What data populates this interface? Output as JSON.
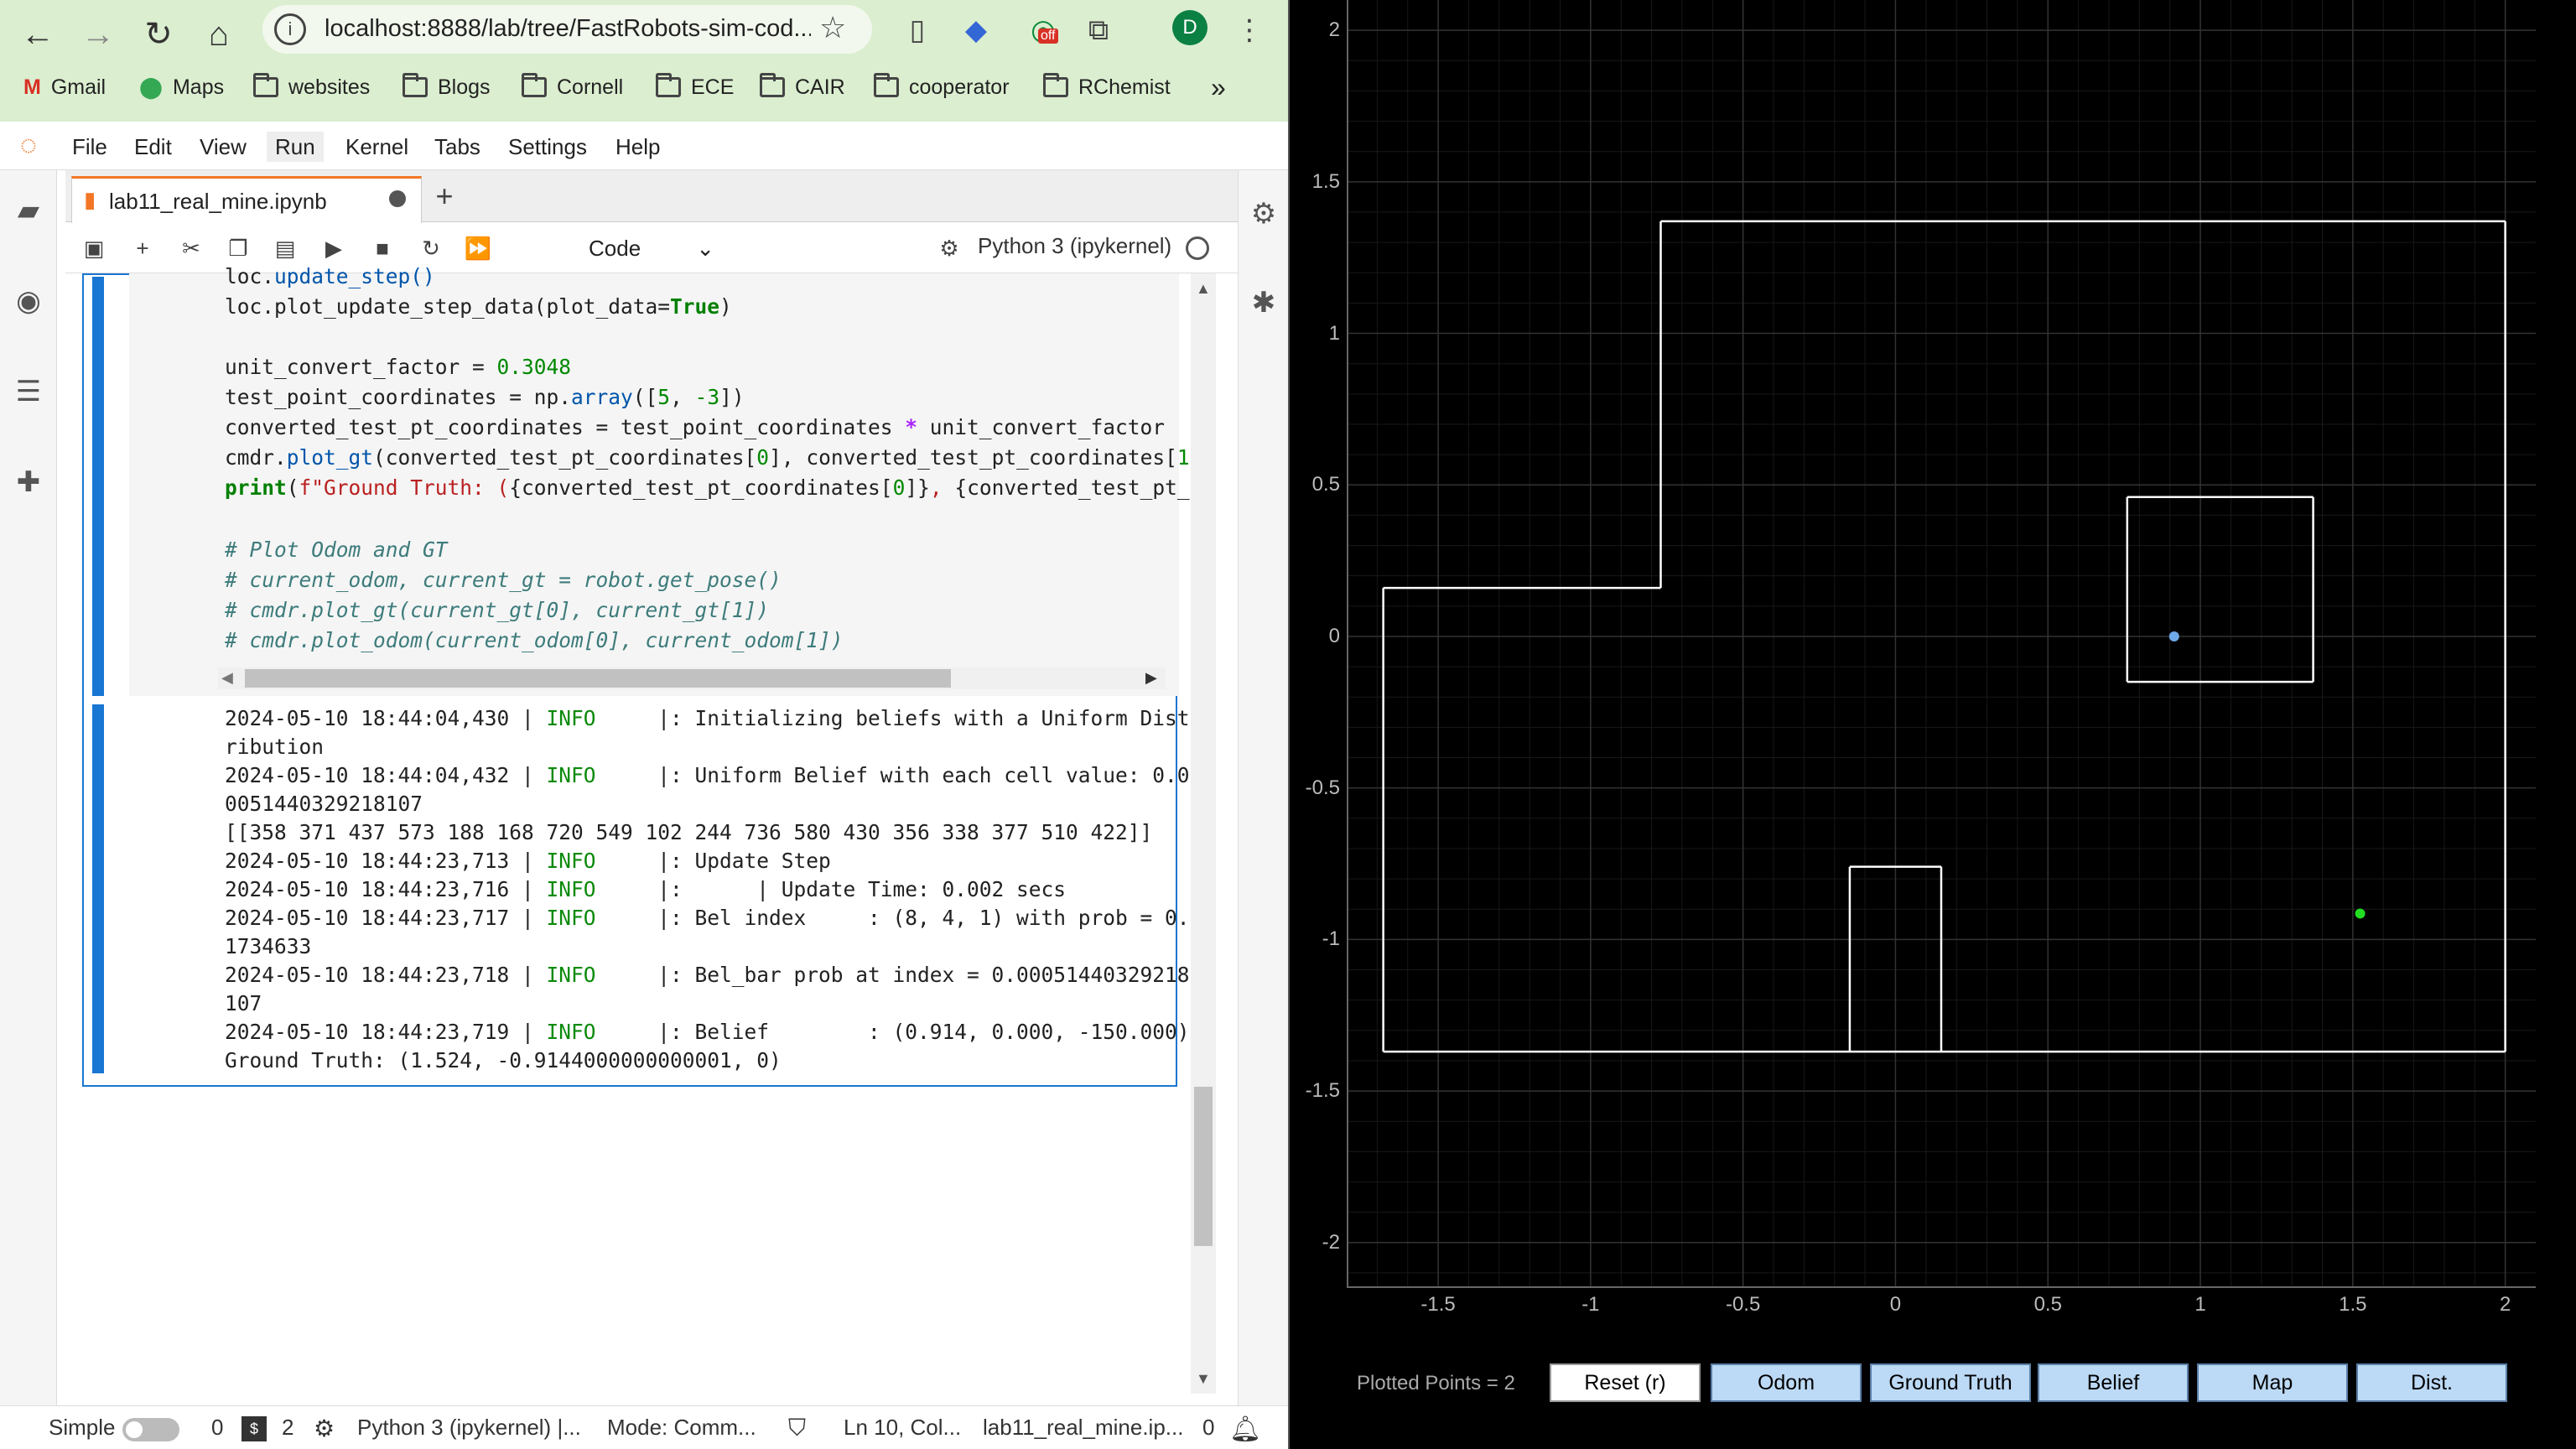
{
  "browser": {
    "url": "localhost:8888/lab/tree/FastRobots-sim-cod...",
    "profile_initial": "D",
    "bookmarks": [
      "Gmail",
      "Maps",
      "websites",
      "Blogs",
      "Cornell",
      "ECE",
      "CAIR",
      "cooperator",
      "RChemist"
    ],
    "more_label": "»",
    "ext_badge": "off"
  },
  "jupyter": {
    "menus": [
      "File",
      "Edit",
      "View",
      "Run",
      "Kernel",
      "Tabs",
      "Settings",
      "Help"
    ],
    "tab_title": "lab11_real_mine.ipynb",
    "cell_type": "Code",
    "kernel": "Python 3 (ipykernel)"
  },
  "code_lines": [
    "loc.update_step()",
    "loc.plot_update_step_data(plot_data=True)",
    "",
    "unit_convert_factor = 0.3048",
    "test_point_coordinates = np.array([5, -3])",
    "converted_test_pt_coordinates = test_point_coordinates * unit_convert_factor",
    "cmdr.plot_gt(converted_test_pt_coordinates[0], converted_test_pt_coordinates[1]",
    "print(f\"Ground Truth: ({converted_test_pt_coordinates[0]}, {converted_test_pt_c",
    "",
    "# Plot Odom and GT",
    "# current_odom, current_gt = robot.get_pose()",
    "# cmdr.plot_gt(current_gt[0], current_gt[1])",
    "# cmdr.plot_odom(current_odom[0], current_odom[1])"
  ],
  "output_lines": [
    {
      "ts": "2024-05-10 18:44:04,430 | ",
      "lvl": "INFO",
      "msg": "     |: Initializing beliefs with a Uniform Dist"
    },
    {
      "ts": "ribution",
      "lvl": "",
      "msg": ""
    },
    {
      "ts": "2024-05-10 18:44:04,432 | ",
      "lvl": "INFO",
      "msg": "     |: Uniform Belief with each cell value: 0.0"
    },
    {
      "ts": "0051440329218107",
      "lvl": "",
      "msg": ""
    },
    {
      "ts": "[[358 371 437 573 188 168 720 549 102 244 736 580 430 356 338 377 510 422]]",
      "lvl": "",
      "msg": ""
    },
    {
      "ts": "2024-05-10 18:44:23,713 | ",
      "lvl": "INFO",
      "msg": "     |: Update Step"
    },
    {
      "ts": "2024-05-10 18:44:23,716 | ",
      "lvl": "INFO",
      "msg": "     |:      | Update Time: 0.002 secs"
    },
    {
      "ts": "2024-05-10 18:44:23,717 | ",
      "lvl": "INFO",
      "msg": "     |: Bel index     : (8, 4, 1) with prob = 0."
    },
    {
      "ts": "1734633",
      "lvl": "",
      "msg": ""
    },
    {
      "ts": "2024-05-10 18:44:23,718 | ",
      "lvl": "INFO",
      "msg": "     |: Bel_bar prob at index = 0.00051440329218"
    },
    {
      "ts": "107",
      "lvl": "",
      "msg": ""
    },
    {
      "ts": "2024-05-10 18:44:23,719 | ",
      "lvl": "INFO",
      "msg": "     |: Belief        : (0.914, 0.000, -150.000)"
    },
    {
      "ts": "Ground Truth: (1.524, -0.9144000000000001, 0)",
      "lvl": "",
      "msg": ""
    }
  ],
  "status": {
    "mode_simple": "Simple",
    "count0": "0",
    "count2": "2",
    "kernel": "Python 3 (ipykernel) |...",
    "mode": "Mode: Comm...",
    "position": "Ln 10, Col...",
    "file": "lab11_real_mine.ip...",
    "notifications": "0"
  },
  "plotter": {
    "plotted_points": "Plotted Points = 2",
    "buttons": [
      "Reset (r)",
      "Odom",
      "Ground Truth",
      "Belief",
      "Map",
      "Dist."
    ],
    "colors": {
      "map": "#ffffff",
      "ground_truth": "#22dd22",
      "belief": "#6fa8e8",
      "grid": "#333333"
    }
  },
  "chart_data": {
    "type": "scatter",
    "xlim": [
      -1.8,
      2.1
    ],
    "ylim": [
      -2.15,
      2.1
    ],
    "x_ticks": [
      -1.5,
      -1,
      -0.5,
      0,
      0.5,
      1,
      1.5,
      2
    ],
    "y_ticks": [
      2,
      1.5,
      1,
      0.5,
      0,
      -0.5,
      -1,
      -1.5,
      -2
    ],
    "x_tick_labels": [
      "-1.5",
      "-1",
      "-0.5",
      "0",
      "0.5",
      "1",
      "1.5",
      "2"
    ],
    "y_tick_labels": [
      "2",
      "1.5",
      "1",
      "0.5",
      "0",
      "-0.5",
      "-1",
      "-1.5",
      "-2"
    ],
    "map_segments": [
      [
        [
          -1.68,
          0.16
        ],
        [
          -0.77,
          0.16
        ]
      ],
      [
        [
          -0.77,
          0.16
        ],
        [
          -0.77,
          1.37
        ]
      ],
      [
        [
          -0.77,
          1.37
        ],
        [
          2.0,
          1.37
        ]
      ],
      [
        [
          2.0,
          1.37
        ],
        [
          2.0,
          -1.37
        ]
      ],
      [
        [
          2.0,
          -1.37
        ],
        [
          -1.68,
          -1.37
        ]
      ],
      [
        [
          -1.68,
          -1.37
        ],
        [
          -1.68,
          0.16
        ]
      ],
      [
        [
          0.76,
          0.46
        ],
        [
          1.37,
          0.46
        ]
      ],
      [
        [
          1.37,
          0.46
        ],
        [
          1.37,
          -0.15
        ]
      ],
      [
        [
          1.37,
          -0.15
        ],
        [
          0.76,
          -0.15
        ]
      ],
      [
        [
          0.76,
          -0.15
        ],
        [
          0.76,
          0.46
        ]
      ],
      [
        [
          -0.15,
          -1.37
        ],
        [
          -0.15,
          -0.76
        ]
      ],
      [
        [
          -0.15,
          -0.76
        ],
        [
          0.15,
          -0.76
        ]
      ],
      [
        [
          0.15,
          -0.76
        ],
        [
          0.15,
          -1.37
        ]
      ]
    ],
    "series": [
      {
        "name": "Ground Truth",
        "points": [
          [
            1.524,
            -0.9144
          ]
        ]
      },
      {
        "name": "Belief",
        "points": [
          [
            0.914,
            0.0
          ]
        ]
      }
    ],
    "grid": true
  }
}
